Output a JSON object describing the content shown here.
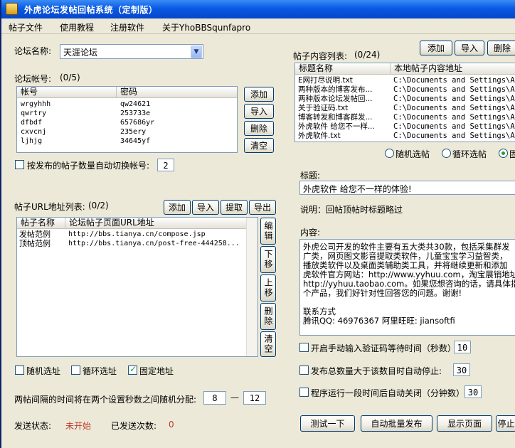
{
  "window": {
    "title": "外虎论坛发帖回帖系统（定制版）"
  },
  "menu": [
    "帖子文件",
    "使用教程",
    "注册软件",
    "关于YhoBBSqunfapro"
  ],
  "forum": {
    "label": "论坛名称:",
    "selected": "天涯论坛"
  },
  "accounts": {
    "label": "论坛帐号:",
    "count": "(0/5)",
    "headers": [
      "帐号",
      "密码"
    ],
    "rows": [
      [
        "wrgyhhh",
        "qw24621"
      ],
      [
        "qwrtry",
        "253733e"
      ],
      [
        "dfbdf",
        "657686yr"
      ],
      [
        "cxvcnj",
        "235ery"
      ],
      [
        "ljhjg",
        "34645yf"
      ]
    ],
    "buttons": {
      "add": "添加",
      "import": "导入",
      "delete": "删除",
      "clear": "清空"
    }
  },
  "auto_switch": {
    "label": "按发布的帖子数量自动切换帐号:",
    "value": "2"
  },
  "urls": {
    "label": "帖子URL地址列表:",
    "count": "(0/2)",
    "buttons": {
      "add": "添加",
      "import": "导入",
      "extract": "提取",
      "export": "导出"
    },
    "headers": [
      "帖子名称",
      "论坛帖子页面URL地址"
    ],
    "rows": [
      [
        "发帖范例",
        "http://bbs.tianya.cn/compose.jsp"
      ],
      [
        "顶帖范例",
        "http://bbs.tianya.cn/post-free-444258..."
      ]
    ],
    "side_buttons": {
      "edit": "编辑",
      "down": "下移",
      "up": "上移",
      "delete": "删除",
      "clear": "清空"
    },
    "modes": {
      "random": "随机选址",
      "cycle": "循环选址",
      "fixed": "固定地址"
    }
  },
  "interval": {
    "label": "两帖间隔的时间将在两个设置秒数之间随机分配:",
    "from": "8",
    "dash": "—",
    "to": "12"
  },
  "status": {
    "label": "发送状态:",
    "value": "未开始",
    "sent_label": "已发送次数:",
    "sent_value": "0"
  },
  "posts": {
    "label": "帖子内容列表:",
    "count": "(0/24)",
    "buttons": {
      "add": "添加",
      "import": "导入",
      "delete": "删除"
    },
    "headers": [
      "标题名称",
      "本地帖子内容地址"
    ],
    "rows": [
      [
        "E网打尽说明.txt",
        "C:\\Documents and Settings\\Adm"
      ],
      [
        "两种版本的博客发布...",
        "C:\\Documents and Settings\\Adm"
      ],
      [
        "两种版本论坛发帖回...",
        "C:\\Documents and Settings\\Adm"
      ],
      [
        "关于验证码.txt",
        "C:\\Documents and Settings\\Adm"
      ],
      [
        "博客转发和博客群发...",
        "C:\\Documents and Settings\\Adm"
      ],
      [
        "外虎软件 给您不一样...",
        "C:\\Documents and Settings\\Adm"
      ],
      [
        "外虎软件.txt",
        "C:\\Documents and Settings\\Adm"
      ]
    ],
    "modes": {
      "random": "随机选帖",
      "cycle": "循环选帖",
      "fixed": "固"
    }
  },
  "title_field": {
    "label": "标题:",
    "value": "外虎软件 给您不一样的体验!"
  },
  "note": "说明：回帖顶帖时标题略过",
  "content": {
    "label": "内容:",
    "lines": [
      "外虎公司开发的软件主要有五大类共30款，包括采集群发",
      "广类，网页图文影音提取类软件，儿童宝宝学习益智类，",
      "播放类软件以及桌面类辅助类工具，并将继续更新和添加",
      "虎软件官方网站：http://www.yyhuu.com，淘宝展销地址",
      "http://yyhuu.taobao.com。如果您想咨询的话，请具体指",
      "个产品，我们好针对性回答您的问题。谢谢!",
      "",
      "联系方式",
      "腾讯QQ: 46976367 阿里旺旺: jiansoftfi"
    ]
  },
  "options": {
    "captcha": {
      "label": "开启手动输入验证码等待时间（秒数）",
      "value": "10"
    },
    "stop_after": {
      "label": "发布总数量大于该数目时自动停止:",
      "value": "30"
    },
    "auto_close": {
      "label": "程序运行一段时间后自动关闭（分钟数）:",
      "value": "30"
    }
  },
  "actions": {
    "test": "测试一下",
    "auto_publish": "自动批量发布",
    "show_page": "显示页面",
    "stop": "停止"
  }
}
